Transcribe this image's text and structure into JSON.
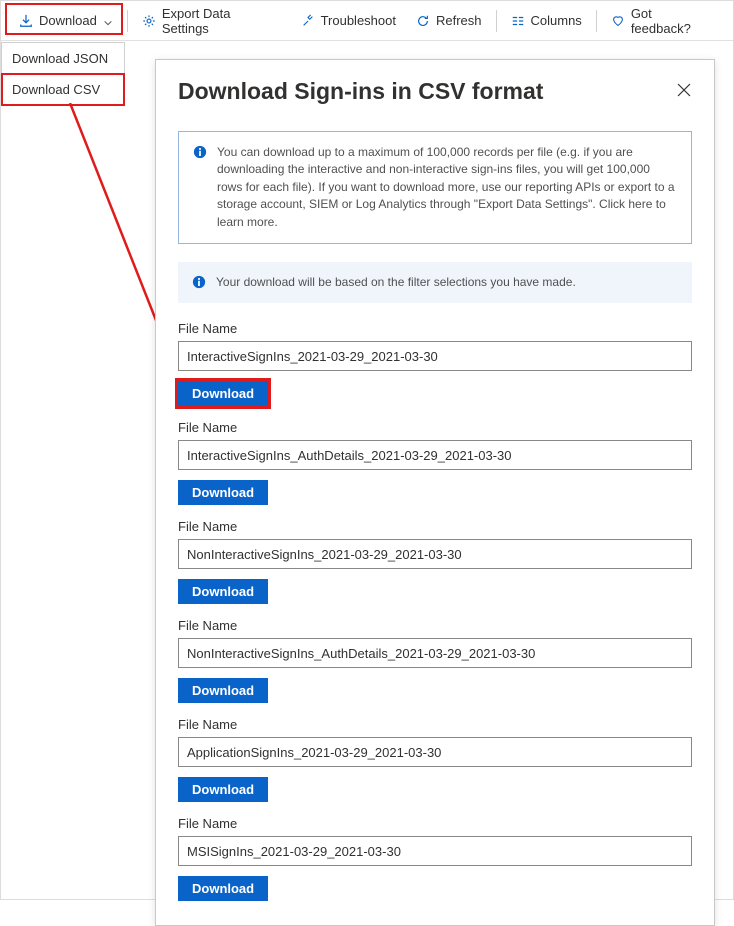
{
  "toolbar": {
    "download_label": "Download",
    "export_label": "Export Data Settings",
    "troubleshoot_label": "Troubleshoot",
    "refresh_label": "Refresh",
    "columns_label": "Columns",
    "feedback_label": "Got feedback?"
  },
  "dropdown": {
    "json_label": "Download JSON",
    "csv_label": "Download CSV"
  },
  "panel": {
    "title": "Download Sign-ins in CSV format",
    "info1": "You can download up to a maximum of 100,000 records per file (e.g. if you are downloading the interactive and non-interactive sign-ins files, you will get 100,000 rows for each file).  If you want to download more, use our reporting APIs or export to a storage account, SIEM or Log Analytics through \"Export Data Settings\". Click here to learn more.",
    "info2": "Your download will be based on the filter selections you have made.",
    "file_label": "File Name",
    "download_btn": "Download",
    "files": [
      {
        "value": "InteractiveSignIns_2021-03-29_2021-03-30"
      },
      {
        "value": "InteractiveSignIns_AuthDetails_2021-03-29_2021-03-30"
      },
      {
        "value": "NonInteractiveSignIns_2021-03-29_2021-03-30"
      },
      {
        "value": "NonInteractiveSignIns_AuthDetails_2021-03-29_2021-03-30"
      },
      {
        "value": "ApplicationSignIns_2021-03-29_2021-03-30"
      },
      {
        "value": "MSISignIns_2021-03-29_2021-03-30"
      }
    ]
  }
}
